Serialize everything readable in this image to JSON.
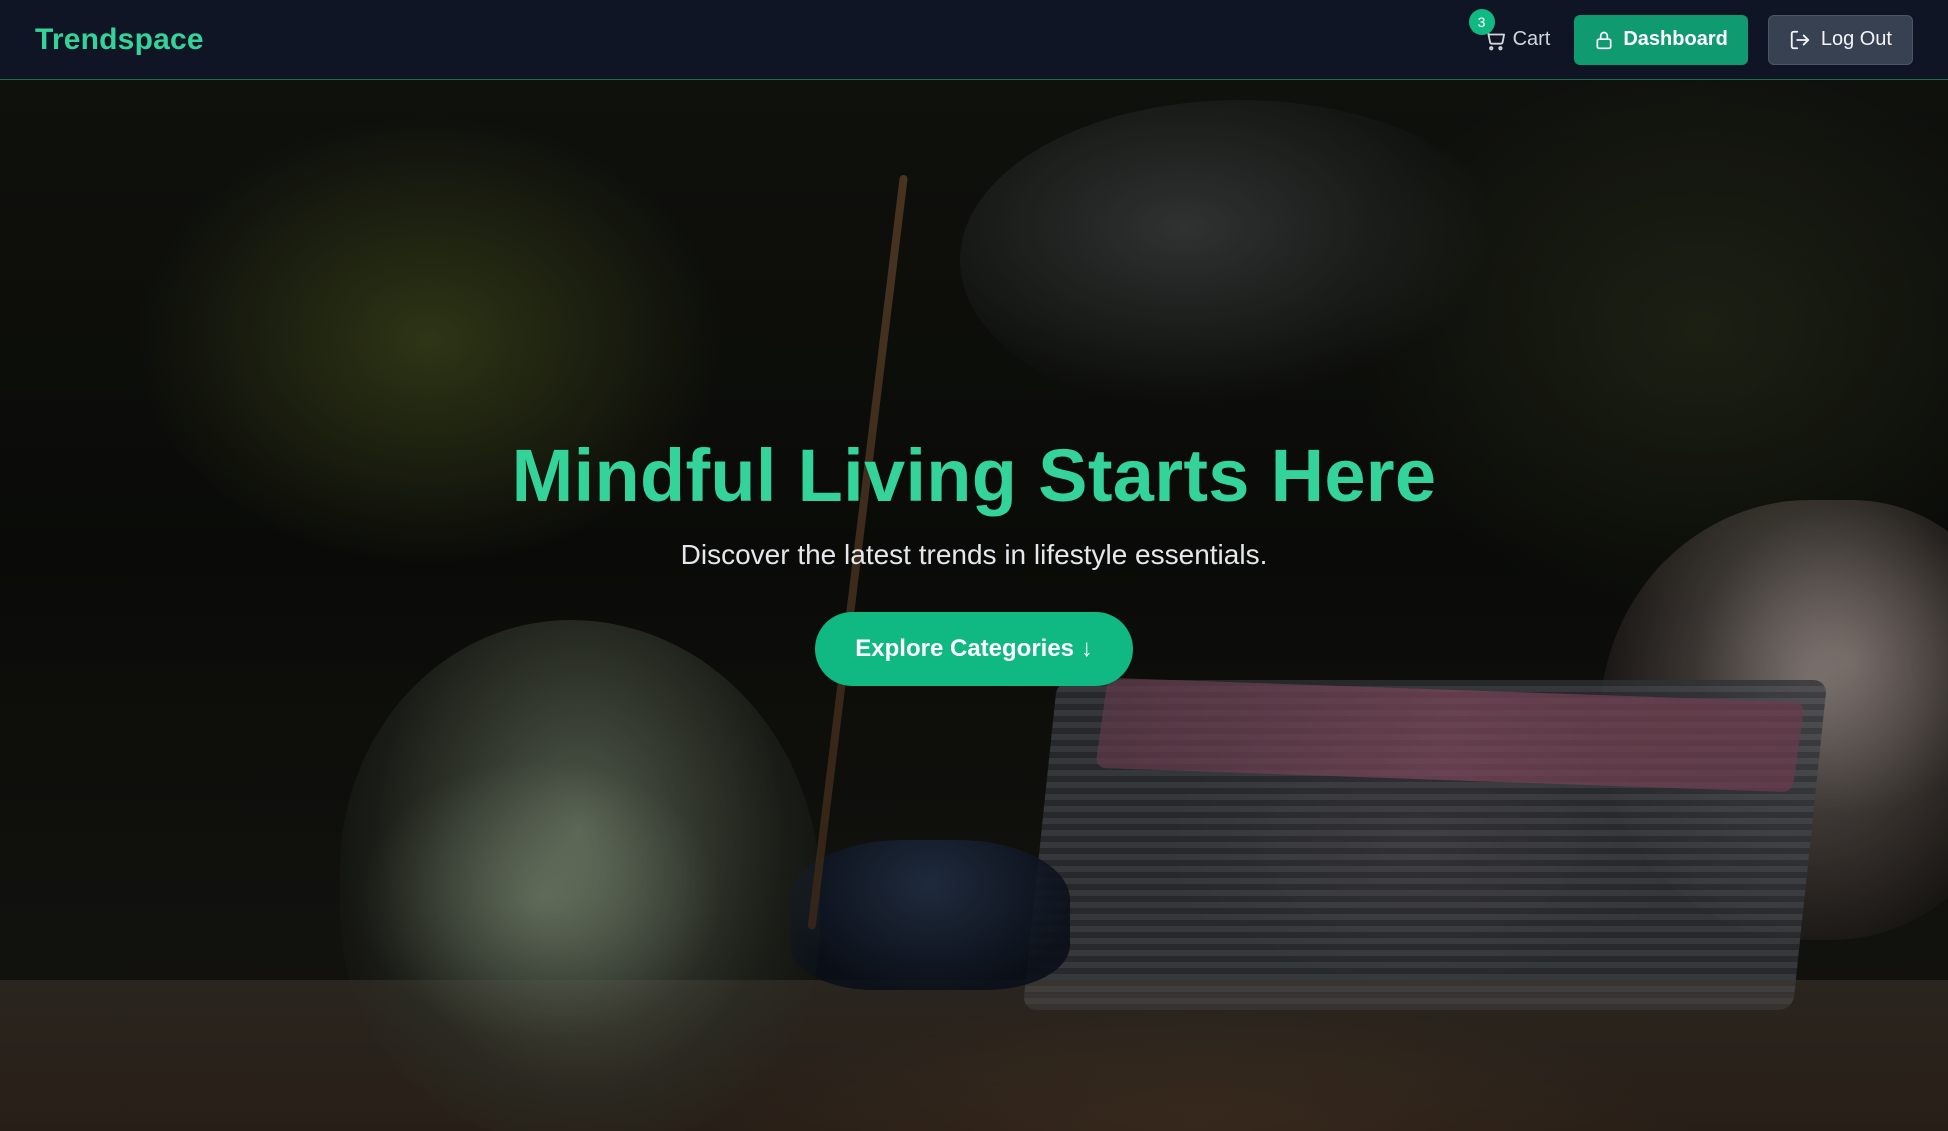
{
  "header": {
    "brand": "Trendspace",
    "cart": {
      "label": "Cart",
      "count": "3",
      "icon": "cart-icon"
    },
    "dashboard_button": {
      "label": "Dashboard",
      "icon": "lock-icon"
    },
    "logout_button": {
      "label": "Log Out",
      "icon": "logout-icon"
    }
  },
  "hero": {
    "title": "Mindful Living Starts Here",
    "subtitle": "Discover the latest trends in lifestyle essentials.",
    "cta_label": "Explore Categories ↓"
  },
  "colors": {
    "accent": "#34d399",
    "button_primary": "#10b981",
    "nav_background": "#0f1524",
    "logout_background": "#374151"
  }
}
